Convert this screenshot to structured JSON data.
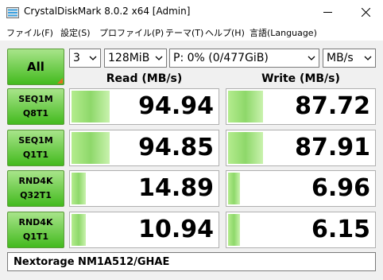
{
  "window": {
    "title": "CrystalDiskMark 8.0.2 x64 [Admin]",
    "minimize_glyph": "—",
    "close_glyph": "✕"
  },
  "menu": [
    {
      "label": "ファイル(F)"
    },
    {
      "label": "設定(S)"
    },
    {
      "label": "プロファイル(P)"
    },
    {
      "label": "テーマ(T)"
    },
    {
      "label": "ヘルプ(H)"
    },
    {
      "label": "言語(Language)"
    }
  ],
  "controls": {
    "all_label": "All",
    "count": "3",
    "size": "128MiB",
    "drive": "P: 0% (0/477GiB)",
    "unit": "MB/s"
  },
  "headers": {
    "read": "Read (MB/s)",
    "write": "Write (MB/s)"
  },
  "tests": [
    {
      "line1": "SEQ1M",
      "line2": "Q8T1",
      "read": "94.94",
      "write": "87.72",
      "read_fill": 0.26,
      "write_fill": 0.24
    },
    {
      "line1": "SEQ1M",
      "line2": "Q1T1",
      "read": "94.85",
      "write": "87.91",
      "read_fill": 0.26,
      "write_fill": 0.24
    },
    {
      "line1": "RND4K",
      "line2": "Q32T1",
      "read": "14.89",
      "write": "6.96",
      "read_fill": 0.1,
      "write_fill": 0.08
    },
    {
      "line1": "RND4K",
      "line2": "Q1T1",
      "read": "10.94",
      "write": "6.15",
      "read_fill": 0.1,
      "write_fill": 0.08
    }
  ],
  "comment": "Nextorage NM1A512/GHAE",
  "colors": {
    "button_green_top": "#a8e48a",
    "button_green_bottom": "#43ba1e",
    "bar_green": "#8ed86a",
    "all_corner_orange": "#e07020"
  }
}
